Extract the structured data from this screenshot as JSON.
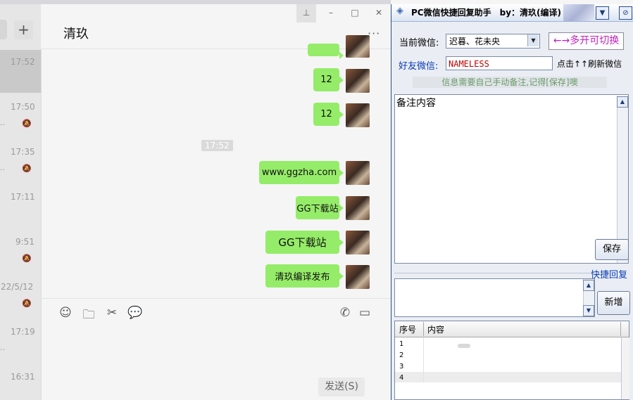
{
  "wechat": {
    "chat_title": "清玖",
    "more_glyph": "···",
    "plus_glyph": "+",
    "window_buttons": {
      "pin": "⊥",
      "minimize": "–",
      "maximize": "□",
      "close": "✕"
    },
    "chat_list_times": [
      "17:52",
      "17:50",
      "17:35",
      "17:11",
      "9:51",
      "22/5/12",
      "17:19",
      "16:31"
    ],
    "messages": [
      "12",
      "12",
      "www.ggzha.com",
      "GG下载站",
      "GG下载站",
      "清玖编译发布"
    ],
    "timestamp": "17:52",
    "send_label": "发送(S)"
  },
  "tool": {
    "title": "PC微信快捷回复助手　by：清玖(编译)",
    "current_wx_label": "当前微信:",
    "current_wx_value": "迟暮、花未央",
    "switch_button": "←→多开可切换",
    "friend_label": "好友微信:",
    "friend_value": "NAMELESS",
    "refresh_label": "点击↑↑刷新微信",
    "hint": "信息需要自己手动备注,记得[保存]噢",
    "notes_content": "备注内容",
    "save_button": "保存",
    "quick_reply_label": "快捷回复",
    "new_button": "新增",
    "table": {
      "col_index": "序号",
      "col_content": "内容",
      "rows": [
        "1",
        "2",
        "3",
        "4"
      ]
    }
  },
  "icons": [
    "emoji-icon",
    "folder-icon",
    "scissors-icon",
    "chat-bubble-icon",
    "phone-icon",
    "video-icon",
    "mute-bell-icon"
  ]
}
